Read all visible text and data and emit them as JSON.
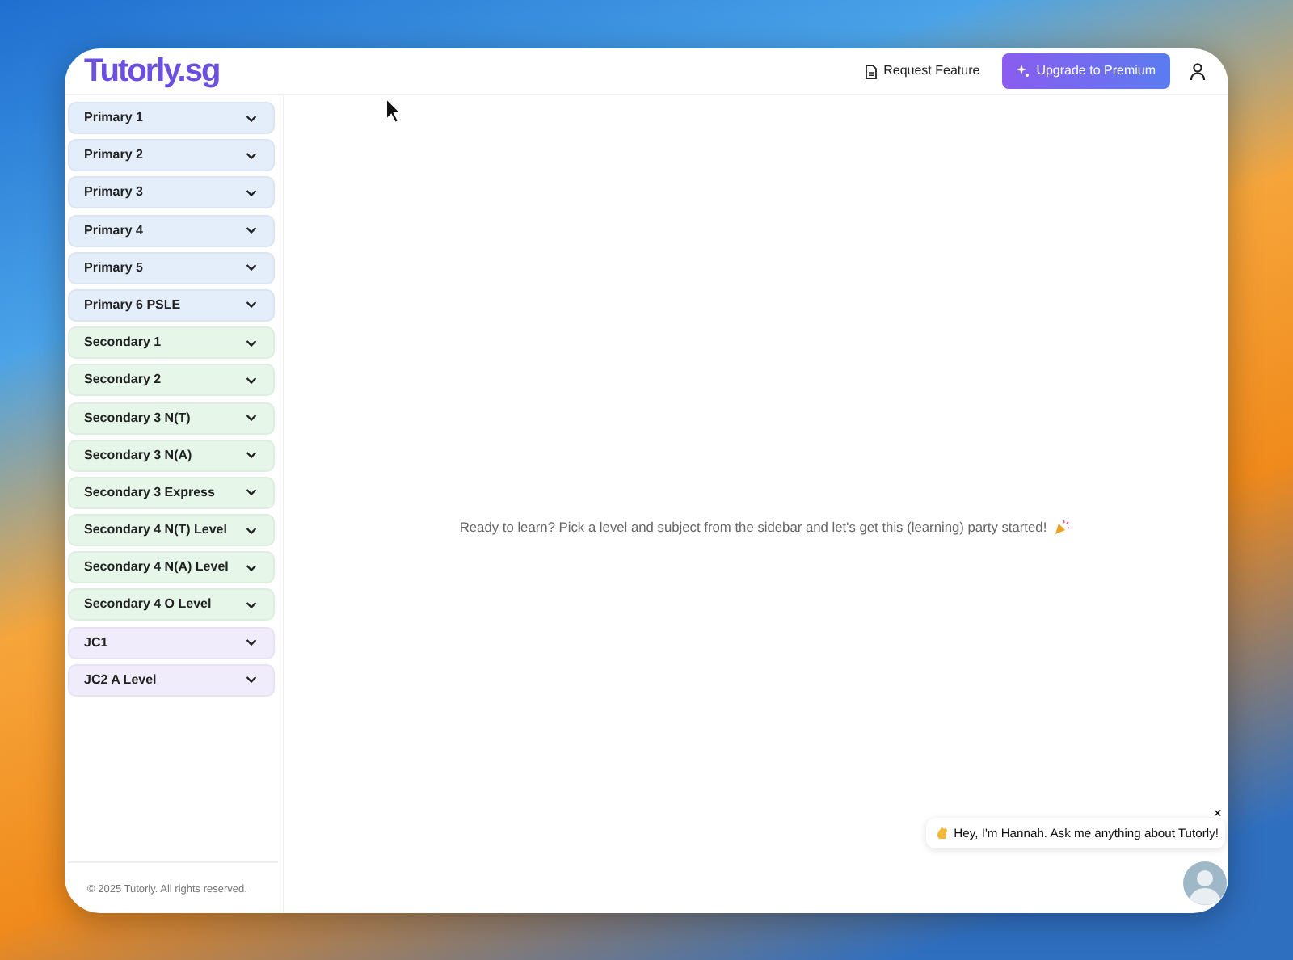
{
  "header": {
    "logo": "Tutorly.sg",
    "request_button": "Request Feature",
    "upgrade_button": "Upgrade to Premium"
  },
  "sidebar": {
    "items": [
      {
        "label": "Primary 1",
        "color": "#e4eefb",
        "expanded": false
      },
      {
        "label": "Primary 2",
        "color": "#e4eefb",
        "expanded": false
      },
      {
        "label": "Primary 3",
        "color": "#e4eefb",
        "expanded": false
      },
      {
        "label": "Primary 4",
        "color": "#e4eefb",
        "expanded": false
      },
      {
        "label": "Primary 5",
        "color": "#e4eefb",
        "expanded": false
      },
      {
        "label": "Primary 6 PSLE",
        "color": "#e4eefb",
        "expanded": false
      },
      {
        "label": "Secondary 1",
        "color": "#e6f7ea",
        "expanded": false
      },
      {
        "label": "Secondary 2",
        "color": "#e6f7ea",
        "expanded": false
      },
      {
        "label": "Secondary 3 N(T)",
        "color": "#e6f7ea",
        "expanded": false
      },
      {
        "label": "Secondary 3 N(A)",
        "color": "#e6f7ea",
        "expanded": false
      },
      {
        "label": "Secondary 3 Express",
        "color": "#e6f7ea",
        "expanded": false
      },
      {
        "label": "Secondary 4 N(T) Level",
        "color": "#e6f7ea",
        "expanded": false
      },
      {
        "label": "Secondary 4 N(A) Level",
        "color": "#e6f7ea",
        "expanded": false
      },
      {
        "label": "Secondary 4 O Level",
        "color": "#e6f7ea",
        "expanded": false
      },
      {
        "label": "JC1",
        "color": "#f1ecfb",
        "expanded": false
      },
      {
        "label": "JC2 A Level",
        "color": "#f1ecfb",
        "expanded": false
      }
    ],
    "footer": "© 2025 Tutorly. All rights reserved."
  },
  "main": {
    "message": "Ready to learn? Pick a level and subject from the sidebar and let's get this (learning) party started!"
  },
  "chat": {
    "bubble": "Hey, I'm Hannah. Ask me anything about Tutorly!",
    "close": "×"
  }
}
